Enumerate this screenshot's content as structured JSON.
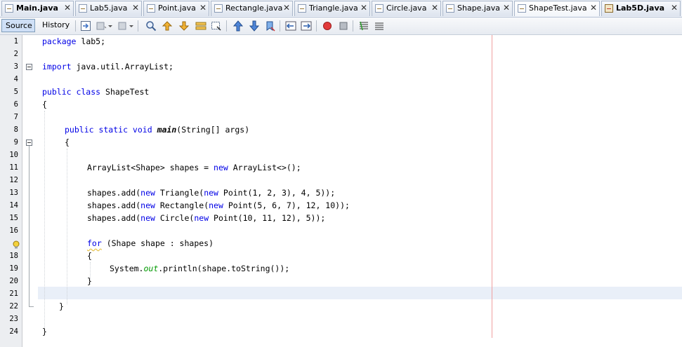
{
  "tabs": [
    {
      "label": "Main.java",
      "bold": true,
      "project": false
    },
    {
      "label": "Lab5.java",
      "bold": false,
      "project": false
    },
    {
      "label": "Point.java",
      "bold": false,
      "project": false
    },
    {
      "label": "Rectangle.java",
      "bold": false,
      "project": false
    },
    {
      "label": "Triangle.java",
      "bold": false,
      "project": false
    },
    {
      "label": "Circle.java",
      "bold": false,
      "project": false
    },
    {
      "label": "Shape.java",
      "bold": false,
      "project": false
    },
    {
      "label": "ShapeTest.java",
      "bold": false,
      "project": false,
      "active": true
    },
    {
      "label": "Lab5D.java",
      "bold": true,
      "project": true
    }
  ],
  "toolbar": {
    "source_label": "Source",
    "history_label": "History"
  },
  "editor": {
    "line_numbers": [
      "1",
      "2",
      "3",
      "4",
      "5",
      "6",
      "7",
      "8",
      "9",
      "10",
      "11",
      "12",
      "13",
      "14",
      "15",
      "16",
      "17",
      "18",
      "19",
      "20",
      "21",
      "22",
      "23",
      "24"
    ],
    "current_line": 21,
    "hint_line": 17
  },
  "colors": {
    "keyword": "#0000e6",
    "field": "#009900",
    "current_line_bg": "#e9eff8",
    "margin_line": "#f0a0a0"
  }
}
